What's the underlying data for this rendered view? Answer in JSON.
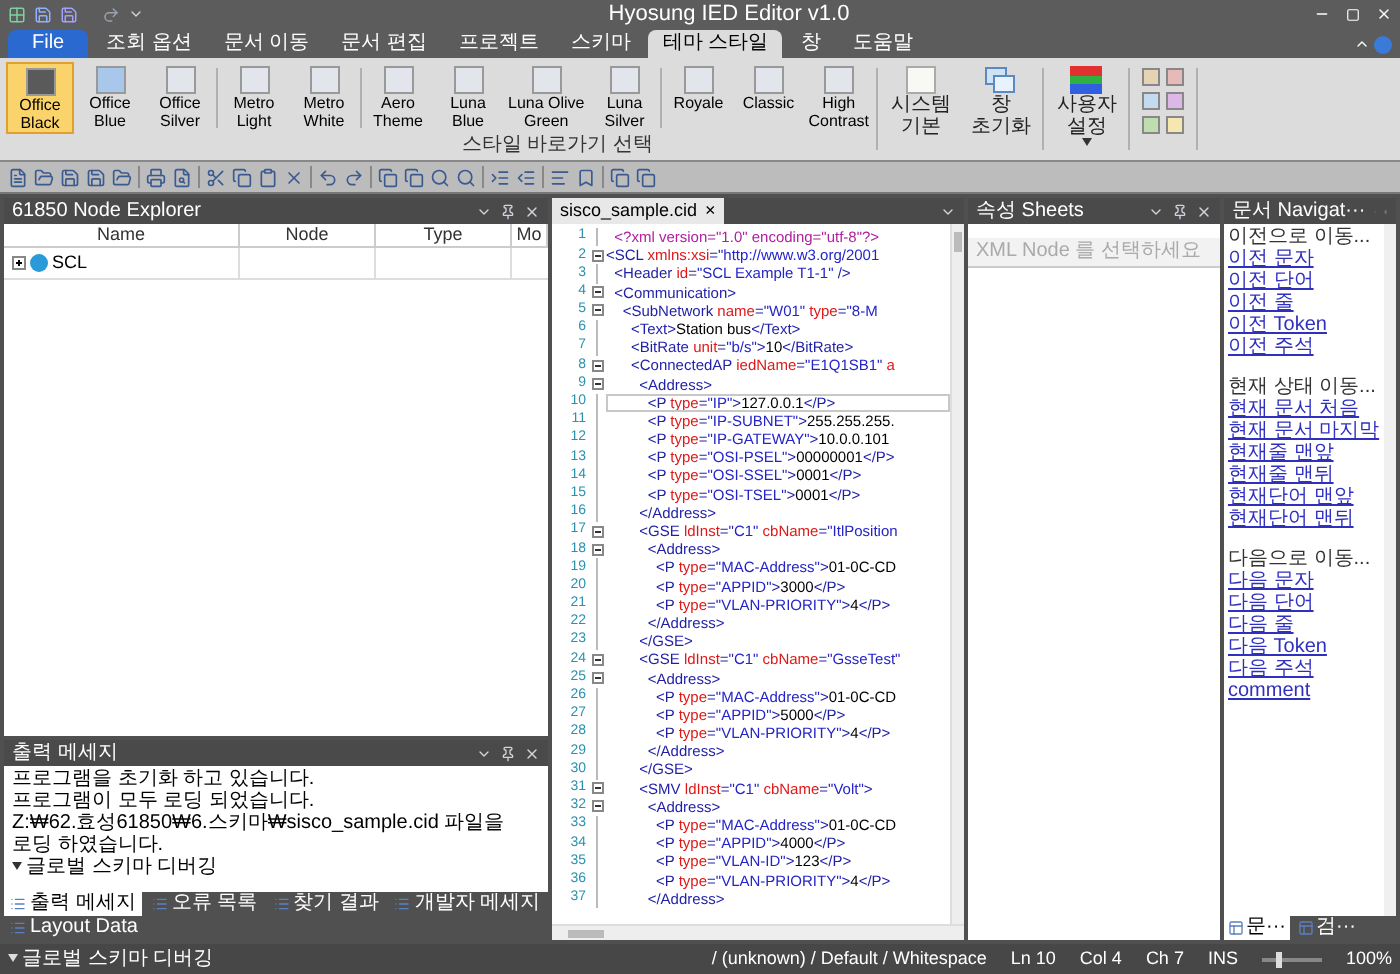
{
  "window": {
    "title": "Hyosung IED Editor v1.0"
  },
  "ribbon": {
    "tabs": [
      {
        "label": "File",
        "kind": "file",
        "selected": false
      },
      {
        "label": "조회 옵션",
        "kind": "tab",
        "selected": false
      },
      {
        "label": "문서 이동",
        "kind": "tab",
        "selected": false
      },
      {
        "label": "문서 편집",
        "kind": "tab",
        "selected": false
      },
      {
        "label": "프로젝트",
        "kind": "tab",
        "selected": false
      },
      {
        "label": "스키마",
        "kind": "tab",
        "selected": false
      },
      {
        "label": "테마 스타일",
        "kind": "tab",
        "selected": true
      },
      {
        "label": "창",
        "kind": "tab",
        "selected": false
      },
      {
        "label": "도움말",
        "kind": "tab",
        "selected": false
      }
    ],
    "theme_group": {
      "label": "스타일 바로가기 선택",
      "buttons": [
        {
          "label": "Office\nBlack",
          "color": "#5a5a5a",
          "selected": true
        },
        {
          "label": "Office\nBlue",
          "color": "#a9c7ea",
          "selected": false
        },
        {
          "label": "Office\nSilver",
          "color": "#e2e6ec",
          "selected": false
        },
        {
          "label": "Metro\nLight",
          "color": "#e2e6ec",
          "selected": false
        },
        {
          "label": "Metro\nWhite",
          "color": "#e2e6ec",
          "selected": false
        },
        {
          "label": "Aero\nTheme",
          "color": "#e2e6ec",
          "selected": false
        },
        {
          "label": "Luna\nBlue",
          "color": "#e2e6ec",
          "selected": false
        },
        {
          "label": "Luna Olive\nGreen",
          "color": "#e2e6ec",
          "selected": false
        },
        {
          "label": "Luna\nSilver",
          "color": "#e2e6ec",
          "selected": false
        },
        {
          "label": "Royale",
          "color": "#e2e6ec",
          "selected": false
        },
        {
          "label": "Classic",
          "color": "#e2e6ec",
          "selected": false
        },
        {
          "label": "High\nContrast",
          "color": "#e2e6ec",
          "selected": false
        }
      ]
    },
    "system_buttons": [
      {
        "label": "시스템\n기본",
        "kind": "blank",
        "dropdown": false
      },
      {
        "label": "창\n초기화",
        "kind": "windows",
        "dropdown": false
      },
      {
        "label": "사용자\n설정",
        "kind": "rgb",
        "dropdown": true
      }
    ],
    "swatches": [
      {
        "color": "#e6d3b3"
      },
      {
        "color": "#e8b9b9"
      },
      {
        "color": "#c4dbef"
      },
      {
        "color": "#dcb8e6"
      },
      {
        "color": "#bfdeb0"
      },
      {
        "color": "#f6e6b0"
      }
    ]
  },
  "node_explorer": {
    "title": "61850 Node Explorer",
    "columns": [
      "Name",
      "Node",
      "Type",
      "Mo"
    ],
    "rows": [
      {
        "name": "SCL",
        "expanded": false
      }
    ]
  },
  "editor": {
    "tab": "sisco_sample.cid",
    "close": "×",
    "lines": [
      {
        "number": "1",
        "fold": false,
        "current": false,
        "parts": [
          {
            "kind": "pi",
            "text": "  <?xml version=\"1.0\" encoding=\"utf-8\"?>"
          }
        ]
      },
      {
        "number": "2",
        "fold": true,
        "current": false,
        "parts": [
          {
            "kind": "tag",
            "text": "<SCL"
          },
          {
            "kind": "attr",
            "text": " xmlns:xsi"
          },
          {
            "kind": "tag",
            "text": "="
          },
          {
            "kind": "val",
            "text": "\"http://www.w3.org/2001"
          }
        ]
      },
      {
        "number": "3",
        "fold": false,
        "current": false,
        "parts": [
          {
            "kind": "tag",
            "text": "  <Header"
          },
          {
            "kind": "attr",
            "text": " id"
          },
          {
            "kind": "tag",
            "text": "="
          },
          {
            "kind": "val",
            "text": "\"SCL Example T1-1\""
          },
          {
            "kind": "tag",
            "text": " />"
          }
        ]
      },
      {
        "number": "4",
        "fold": true,
        "current": false,
        "parts": [
          {
            "kind": "tag",
            "text": "  <Communication>"
          }
        ]
      },
      {
        "number": "5",
        "fold": true,
        "current": false,
        "parts": [
          {
            "kind": "tag",
            "text": "    <SubNetwork"
          },
          {
            "kind": "attr",
            "text": " name"
          },
          {
            "kind": "tag",
            "text": "="
          },
          {
            "kind": "val",
            "text": "\"W01\""
          },
          {
            "kind": "attr",
            "text": " type"
          },
          {
            "kind": "tag",
            "text": "="
          },
          {
            "kind": "val",
            "text": "\"8-M"
          }
        ]
      },
      {
        "number": "6",
        "fold": false,
        "current": false,
        "parts": [
          {
            "kind": "tag",
            "text": "      <Text>"
          },
          {
            "kind": "text",
            "text": "Station bus"
          },
          {
            "kind": "tag",
            "text": "</Text>"
          }
        ]
      },
      {
        "number": "7",
        "fold": false,
        "current": false,
        "parts": [
          {
            "kind": "tag",
            "text": "      <BitRate"
          },
          {
            "kind": "attr",
            "text": " unit"
          },
          {
            "kind": "tag",
            "text": "="
          },
          {
            "kind": "val",
            "text": "\"b/s\""
          },
          {
            "kind": "tag",
            "text": ">"
          },
          {
            "kind": "text",
            "text": "10"
          },
          {
            "kind": "tag",
            "text": "</BitRate>"
          }
        ]
      },
      {
        "number": "8",
        "fold": true,
        "current": false,
        "parts": [
          {
            "kind": "tag",
            "text": "      <ConnectedAP"
          },
          {
            "kind": "attr",
            "text": " iedName"
          },
          {
            "kind": "tag",
            "text": "="
          },
          {
            "kind": "val",
            "text": "\"E1Q1SB1\""
          },
          {
            "kind": "attr",
            "text": " a"
          }
        ]
      },
      {
        "number": "9",
        "fold": true,
        "current": false,
        "parts": [
          {
            "kind": "tag",
            "text": "        <Address>"
          }
        ]
      },
      {
        "number": "10",
        "fold": false,
        "current": true,
        "parts": [
          {
            "kind": "tag",
            "text": "          <P"
          },
          {
            "kind": "attr",
            "text": " type"
          },
          {
            "kind": "tag",
            "text": "="
          },
          {
            "kind": "val",
            "text": "\"IP\""
          },
          {
            "kind": "tag",
            "text": ">"
          },
          {
            "kind": "text",
            "text": "127.0.0.1"
          },
          {
            "kind": "tag",
            "text": "</P>"
          }
        ]
      },
      {
        "number": "11",
        "fold": false,
        "current": false,
        "parts": [
          {
            "kind": "tag",
            "text": "          <P"
          },
          {
            "kind": "attr",
            "text": " type"
          },
          {
            "kind": "tag",
            "text": "="
          },
          {
            "kind": "val",
            "text": "\"IP-SUBNET\""
          },
          {
            "kind": "tag",
            "text": ">"
          },
          {
            "kind": "text",
            "text": "255.255.255."
          }
        ]
      },
      {
        "number": "12",
        "fold": false,
        "current": false,
        "parts": [
          {
            "kind": "tag",
            "text": "          <P"
          },
          {
            "kind": "attr",
            "text": " type"
          },
          {
            "kind": "tag",
            "text": "="
          },
          {
            "kind": "val",
            "text": "\"IP-GATEWAY\""
          },
          {
            "kind": "tag",
            "text": ">"
          },
          {
            "kind": "text",
            "text": "10.0.0.101"
          }
        ]
      },
      {
        "number": "13",
        "fold": false,
        "current": false,
        "parts": [
          {
            "kind": "tag",
            "text": "          <P"
          },
          {
            "kind": "attr",
            "text": " type"
          },
          {
            "kind": "tag",
            "text": "="
          },
          {
            "kind": "val",
            "text": "\"OSI-PSEL\""
          },
          {
            "kind": "tag",
            "text": ">"
          },
          {
            "kind": "text",
            "text": "00000001"
          },
          {
            "kind": "tag",
            "text": "</P>"
          }
        ]
      },
      {
        "number": "14",
        "fold": false,
        "current": false,
        "parts": [
          {
            "kind": "tag",
            "text": "          <P"
          },
          {
            "kind": "attr",
            "text": " type"
          },
          {
            "kind": "tag",
            "text": "="
          },
          {
            "kind": "val",
            "text": "\"OSI-SSEL\""
          },
          {
            "kind": "tag",
            "text": ">"
          },
          {
            "kind": "text",
            "text": "0001"
          },
          {
            "kind": "tag",
            "text": "</P>"
          }
        ]
      },
      {
        "number": "15",
        "fold": false,
        "current": false,
        "parts": [
          {
            "kind": "tag",
            "text": "          <P"
          },
          {
            "kind": "attr",
            "text": " type"
          },
          {
            "kind": "tag",
            "text": "="
          },
          {
            "kind": "val",
            "text": "\"OSI-TSEL\""
          },
          {
            "kind": "tag",
            "text": ">"
          },
          {
            "kind": "text",
            "text": "0001"
          },
          {
            "kind": "tag",
            "text": "</P>"
          }
        ]
      },
      {
        "number": "16",
        "fold": false,
        "current": false,
        "parts": [
          {
            "kind": "tag",
            "text": "        </Address>"
          }
        ]
      },
      {
        "number": "17",
        "fold": true,
        "current": false,
        "parts": [
          {
            "kind": "tag",
            "text": "        <GSE"
          },
          {
            "kind": "attr",
            "text": " ldInst"
          },
          {
            "kind": "tag",
            "text": "="
          },
          {
            "kind": "val",
            "text": "\"C1\""
          },
          {
            "kind": "attr",
            "text": " cbName"
          },
          {
            "kind": "tag",
            "text": "="
          },
          {
            "kind": "val",
            "text": "\"ItlPosition"
          }
        ]
      },
      {
        "number": "18",
        "fold": true,
        "current": false,
        "parts": [
          {
            "kind": "tag",
            "text": "          <Address>"
          }
        ]
      },
      {
        "number": "19",
        "fold": false,
        "current": false,
        "parts": [
          {
            "kind": "tag",
            "text": "            <P"
          },
          {
            "kind": "attr",
            "text": " type"
          },
          {
            "kind": "tag",
            "text": "="
          },
          {
            "kind": "val",
            "text": "\"MAC-Address\""
          },
          {
            "kind": "tag",
            "text": ">"
          },
          {
            "kind": "text",
            "text": "01-0C-CD"
          }
        ]
      },
      {
        "number": "20",
        "fold": false,
        "current": false,
        "parts": [
          {
            "kind": "tag",
            "text": "            <P"
          },
          {
            "kind": "attr",
            "text": " type"
          },
          {
            "kind": "tag",
            "text": "="
          },
          {
            "kind": "val",
            "text": "\"APPID\""
          },
          {
            "kind": "tag",
            "text": ">"
          },
          {
            "kind": "text",
            "text": "3000"
          },
          {
            "kind": "tag",
            "text": "</P>"
          }
        ]
      },
      {
        "number": "21",
        "fold": false,
        "current": false,
        "parts": [
          {
            "kind": "tag",
            "text": "            <P"
          },
          {
            "kind": "attr",
            "text": " type"
          },
          {
            "kind": "tag",
            "text": "="
          },
          {
            "kind": "val",
            "text": "\"VLAN-PRIORITY\""
          },
          {
            "kind": "tag",
            "text": ">"
          },
          {
            "kind": "text",
            "text": "4"
          },
          {
            "kind": "tag",
            "text": "</P>"
          }
        ]
      },
      {
        "number": "22",
        "fold": false,
        "current": false,
        "parts": [
          {
            "kind": "tag",
            "text": "          </Address>"
          }
        ]
      },
      {
        "number": "23",
        "fold": false,
        "current": false,
        "parts": [
          {
            "kind": "tag",
            "text": "        </GSE>"
          }
        ]
      },
      {
        "number": "24",
        "fold": true,
        "current": false,
        "parts": [
          {
            "kind": "tag",
            "text": "        <GSE"
          },
          {
            "kind": "attr",
            "text": " ldInst"
          },
          {
            "kind": "tag",
            "text": "="
          },
          {
            "kind": "val",
            "text": "\"C1\""
          },
          {
            "kind": "attr",
            "text": " cbName"
          },
          {
            "kind": "tag",
            "text": "="
          },
          {
            "kind": "val",
            "text": "\"GsseTest\""
          }
        ]
      },
      {
        "number": "25",
        "fold": true,
        "current": false,
        "parts": [
          {
            "kind": "tag",
            "text": "          <Address>"
          }
        ]
      },
      {
        "number": "26",
        "fold": false,
        "current": false,
        "parts": [
          {
            "kind": "tag",
            "text": "            <P"
          },
          {
            "kind": "attr",
            "text": " type"
          },
          {
            "kind": "tag",
            "text": "="
          },
          {
            "kind": "val",
            "text": "\"MAC-Address\""
          },
          {
            "kind": "tag",
            "text": ">"
          },
          {
            "kind": "text",
            "text": "01-0C-CD"
          }
        ]
      },
      {
        "number": "27",
        "fold": false,
        "current": false,
        "parts": [
          {
            "kind": "tag",
            "text": "            <P"
          },
          {
            "kind": "attr",
            "text": " type"
          },
          {
            "kind": "tag",
            "text": "="
          },
          {
            "kind": "val",
            "text": "\"APPID\""
          },
          {
            "kind": "tag",
            "text": ">"
          },
          {
            "kind": "text",
            "text": "5000"
          },
          {
            "kind": "tag",
            "text": "</P>"
          }
        ]
      },
      {
        "number": "28",
        "fold": false,
        "current": false,
        "parts": [
          {
            "kind": "tag",
            "text": "            <P"
          },
          {
            "kind": "attr",
            "text": " type"
          },
          {
            "kind": "tag",
            "text": "="
          },
          {
            "kind": "val",
            "text": "\"VLAN-PRIORITY\""
          },
          {
            "kind": "tag",
            "text": ">"
          },
          {
            "kind": "text",
            "text": "4"
          },
          {
            "kind": "tag",
            "text": "</P>"
          }
        ]
      },
      {
        "number": "29",
        "fold": false,
        "current": false,
        "parts": [
          {
            "kind": "tag",
            "text": "          </Address>"
          }
        ]
      },
      {
        "number": "30",
        "fold": false,
        "current": false,
        "parts": [
          {
            "kind": "tag",
            "text": "        </GSE>"
          }
        ]
      },
      {
        "number": "31",
        "fold": true,
        "current": false,
        "parts": [
          {
            "kind": "tag",
            "text": "        <SMV"
          },
          {
            "kind": "attr",
            "text": " ldInst"
          },
          {
            "kind": "tag",
            "text": "="
          },
          {
            "kind": "val",
            "text": "\"C1\""
          },
          {
            "kind": "attr",
            "text": " cbName"
          },
          {
            "kind": "tag",
            "text": "="
          },
          {
            "kind": "val",
            "text": "\"Volt\""
          },
          {
            "kind": "tag",
            "text": ">"
          }
        ]
      },
      {
        "number": "32",
        "fold": true,
        "current": false,
        "parts": [
          {
            "kind": "tag",
            "text": "          <Address>"
          }
        ]
      },
      {
        "number": "33",
        "fold": false,
        "current": false,
        "parts": [
          {
            "kind": "tag",
            "text": "            <P"
          },
          {
            "kind": "attr",
            "text": " type"
          },
          {
            "kind": "tag",
            "text": "="
          },
          {
            "kind": "val",
            "text": "\"MAC-Address\""
          },
          {
            "kind": "tag",
            "text": ">"
          },
          {
            "kind": "text",
            "text": "01-0C-CD"
          }
        ]
      },
      {
        "number": "34",
        "fold": false,
        "current": false,
        "parts": [
          {
            "kind": "tag",
            "text": "            <P"
          },
          {
            "kind": "attr",
            "text": " type"
          },
          {
            "kind": "tag",
            "text": "="
          },
          {
            "kind": "val",
            "text": "\"APPID\""
          },
          {
            "kind": "tag",
            "text": ">"
          },
          {
            "kind": "text",
            "text": "4000"
          },
          {
            "kind": "tag",
            "text": "</P>"
          }
        ]
      },
      {
        "number": "35",
        "fold": false,
        "current": false,
        "parts": [
          {
            "kind": "tag",
            "text": "            <P"
          },
          {
            "kind": "attr",
            "text": " type"
          },
          {
            "kind": "tag",
            "text": "="
          },
          {
            "kind": "val",
            "text": "\"VLAN-ID\""
          },
          {
            "kind": "tag",
            "text": ">"
          },
          {
            "kind": "text",
            "text": "123"
          },
          {
            "kind": "tag",
            "text": "</P>"
          }
        ]
      },
      {
        "number": "36",
        "fold": false,
        "current": false,
        "parts": [
          {
            "kind": "tag",
            "text": "            <P"
          },
          {
            "kind": "attr",
            "text": " type"
          },
          {
            "kind": "tag",
            "text": "="
          },
          {
            "kind": "val",
            "text": "\"VLAN-PRIORITY\""
          },
          {
            "kind": "tag",
            "text": ">"
          },
          {
            "kind": "text",
            "text": "4"
          },
          {
            "kind": "tag",
            "text": "</P>"
          }
        ]
      },
      {
        "number": "37",
        "fold": false,
        "current": false,
        "parts": [
          {
            "kind": "tag",
            "text": "          </Address>"
          }
        ]
      }
    ]
  },
  "properties": {
    "title": "속성 Sheets",
    "placeholder": "XML Node 를 선택하세요"
  },
  "navigator": {
    "title": "문서 Navigat···",
    "groups": [
      {
        "heading": "이전으로 이동...",
        "links": [
          "이전 문자",
          "이전 단어",
          "이전 줄",
          "이전 Token",
          "이전 주석"
        ]
      },
      {
        "heading": "현재 상태 이동...",
        "links": [
          "현재 문서 처음",
          "현재 문서 마지막",
          "현재줄 맨앞",
          "현재줄 맨뒤",
          "현재단어 맨앞",
          "현재단어 맨뒤"
        ]
      },
      {
        "heading": "다음으로 이동...",
        "links": [
          "다음 문자",
          "다음 단어",
          "다음 줄",
          "다음 Token",
          "다음 주석",
          "comment"
        ]
      }
    ],
    "tabs": [
      {
        "label": "문···",
        "selected": true
      },
      {
        "label": "검···",
        "selected": false
      }
    ]
  },
  "output": {
    "title": "출력 메세지",
    "lines": [
      {
        "kind": "text",
        "text": "프로그램을 초기화 하고 있습니다."
      },
      {
        "kind": "text",
        "text": "프로그램이 모두 로딩 되었습니다."
      },
      {
        "kind": "text",
        "text": "Z:₩62.효성61850₩6.스키마₩sisco_sample.cid 파일을 로딩 하였습니다."
      },
      {
        "kind": "group",
        "text": "글로벌 스키마 디버깅"
      }
    ],
    "tabs": [
      {
        "label": "출력 메세지",
        "selected": true
      },
      {
        "label": "오류 목록",
        "selected": false
      },
      {
        "label": "찾기 결과",
        "selected": false
      },
      {
        "label": "개발자 메세지",
        "selected": false
      },
      {
        "label": "Layout Data",
        "selected": false
      }
    ]
  },
  "status_bar": {
    "message": "글로벌 스키마 디버깅",
    "encoding": "/ (unknown) / Default / Whitespace",
    "line": "Ln 10",
    "column": "Col 4",
    "char": "Ch 7",
    "mode": "INS",
    "zoom": {
      "level": 0.3,
      "reading": "100%"
    }
  }
}
